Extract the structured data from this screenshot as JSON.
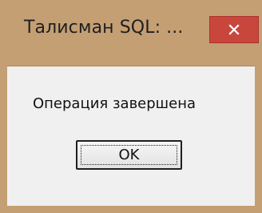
{
  "window": {
    "title": "Талисман SQL: ...",
    "frame_color": "#c49f74",
    "close_button_color": "#c9463d",
    "close_icon": "close-icon"
  },
  "dialog": {
    "message": "Операция завершена",
    "ok_label": "OK"
  }
}
